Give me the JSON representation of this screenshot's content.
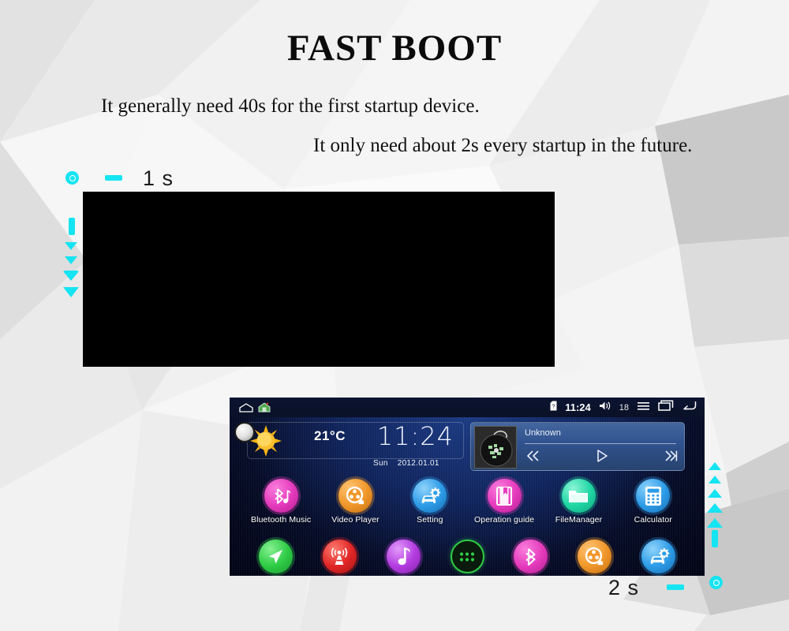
{
  "slide": {
    "title": "FAST BOOT",
    "subtitle_line1": "It generally need 40s for the first startup device.",
    "subtitle_line2": "It only need about 2s every startup in the future.",
    "accent_color": "#15e4f2"
  },
  "annotations": {
    "boot_stage_label": "1 s",
    "home_stage_label": "2 s",
    "down_triangle_count": 5,
    "up_triangle_count": 5
  },
  "boot_screen": {
    "state": "black-blank-boot",
    "background_color": "#000000"
  },
  "android": {
    "statusbar": {
      "home_outline_icon": "home-outline-icon",
      "home_color_icon": "home-color-icon",
      "sdcard_icon": "sdcard-icon",
      "clock": "11:24",
      "volume_icon": "volume-icon",
      "volume_level": "18",
      "menu_icon": "menu-icon",
      "recents_icon": "recents-icon",
      "back_icon": "back-icon"
    },
    "weather_widget": {
      "icon": "sun-icon",
      "temperature": "21°C",
      "time": "11:24",
      "weekday": "Sun",
      "date": "2012.01.01"
    },
    "media_widget": {
      "album_art": "vinyl-record-thumbnail",
      "track_title": "Unknown",
      "prev_icon": "previous-track-icon",
      "play_icon": "play-icon",
      "next_icon": "next-track-icon"
    },
    "apps_row1": [
      {
        "label": "Bluetooth Music",
        "icon": "bluetooth-music-icon",
        "color": "#e53bbd"
      },
      {
        "label": "Video Player",
        "icon": "film-reel-icon",
        "color": "#f0972a"
      },
      {
        "label": "Setting",
        "icon": "car-gear-icon",
        "color": "#2e9ce8"
      },
      {
        "label": "Operation guide",
        "icon": "book-icon",
        "color": "#e53bbd"
      },
      {
        "label": "FileManager",
        "icon": "folder-icon",
        "color": "#1fd6a4"
      },
      {
        "label": "Calculator",
        "icon": "calculator-icon",
        "color": "#2e9ce8"
      }
    ],
    "apps_row2": [
      {
        "label": "",
        "icon": "navigation-arrow-icon",
        "color": "#2ecc46"
      },
      {
        "label": "",
        "icon": "radio-tower-icon",
        "color": "#e02626"
      },
      {
        "label": "",
        "icon": "music-note-icon",
        "color": "#b33ce0"
      },
      {
        "label": "",
        "icon": "app-drawer-icon",
        "color": "#0b2a10"
      },
      {
        "label": "",
        "icon": "bluetooth-icon",
        "color": "#e53bbd"
      },
      {
        "label": "",
        "icon": "film-reel-icon",
        "color": "#f0972a"
      },
      {
        "label": "",
        "icon": "car-gear-icon",
        "color": "#2e9ce8"
      }
    ]
  }
}
